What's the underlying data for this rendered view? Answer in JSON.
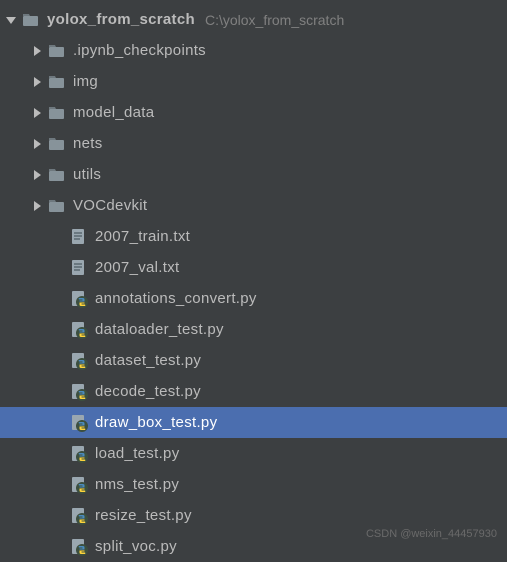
{
  "root": {
    "name": "yolox_from_scratch",
    "path": "C:\\yolox_from_scratch"
  },
  "children": [
    {
      "name": ".ipynb_checkpoints",
      "type": "folder"
    },
    {
      "name": "img",
      "type": "folder"
    },
    {
      "name": "model_data",
      "type": "folder"
    },
    {
      "name": "nets",
      "type": "folder"
    },
    {
      "name": "utils",
      "type": "folder"
    },
    {
      "name": "VOCdevkit",
      "type": "source-folder"
    }
  ],
  "files": [
    {
      "name": "2007_train.txt",
      "type": "text"
    },
    {
      "name": "2007_val.txt",
      "type": "text"
    },
    {
      "name": "annotations_convert.py",
      "type": "python"
    },
    {
      "name": "dataloader_test.py",
      "type": "python"
    },
    {
      "name": "dataset_test.py",
      "type": "python"
    },
    {
      "name": "decode_test.py",
      "type": "python"
    },
    {
      "name": "draw_box_test.py",
      "type": "python",
      "selected": true
    },
    {
      "name": "load_test.py",
      "type": "python"
    },
    {
      "name": "nms_test.py",
      "type": "python"
    },
    {
      "name": "resize_test.py",
      "type": "python"
    },
    {
      "name": "split_voc.py",
      "type": "python"
    }
  ],
  "watermark": "CSDN @weixin_44457930"
}
